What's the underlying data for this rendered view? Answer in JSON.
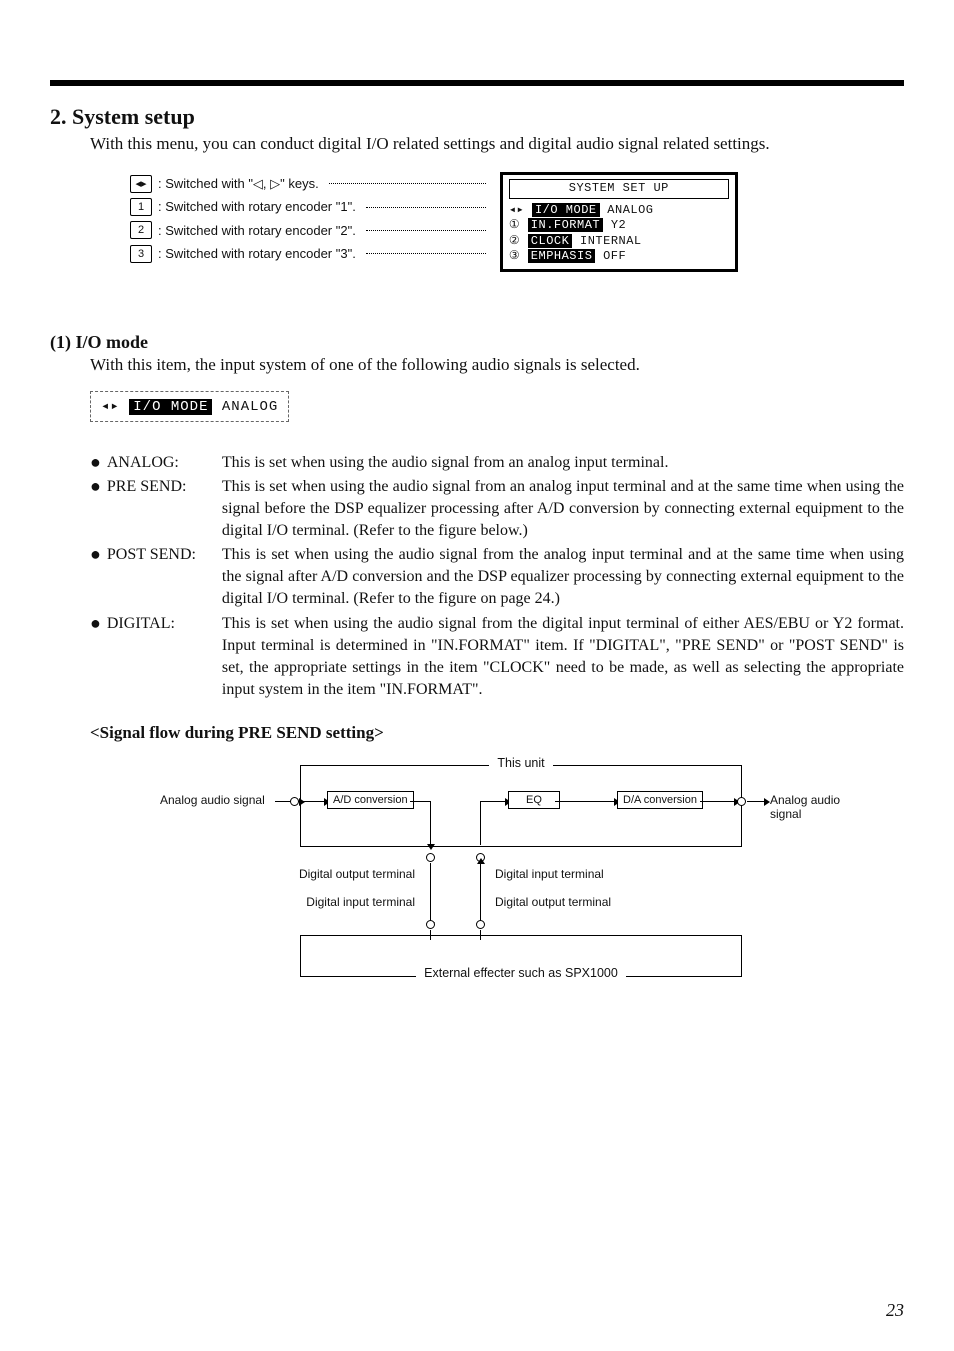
{
  "section": {
    "number": "2.",
    "title": "System setup",
    "intro": "With this menu, you can conduct digital I/O related settings and digital audio signal related settings."
  },
  "legend": {
    "items": [
      {
        "key": "◂▸",
        "text": ": Switched with \"◁, ▷\" keys."
      },
      {
        "key": "1",
        "text": ": Switched with rotary encoder \"1\"."
      },
      {
        "key": "2",
        "text": ": Switched with rotary encoder \"2\"."
      },
      {
        "key": "3",
        "text": ": Switched with rotary encoder \"3\"."
      }
    ]
  },
  "screen": {
    "title": "SYSTEM SET UP",
    "rows": [
      {
        "sym": "◂▸",
        "label": "I/O MODE",
        "value": "ANALOG"
      },
      {
        "sym": "①",
        "label": "IN.FORMAT",
        "value": "Y2"
      },
      {
        "sym": "②",
        "label": "CLOCK",
        "value": "INTERNAL"
      },
      {
        "sym": "③",
        "label": "EMPHASIS",
        "value": "OFF"
      }
    ]
  },
  "sub1": {
    "heading": "(1) I/O mode",
    "intro": "With this item, the input system of one of the following audio signals is selected.",
    "lcd": {
      "sym": "◂▸",
      "label": "I/O MODE",
      "value": "ANALOG"
    }
  },
  "options": [
    {
      "term": "ANALOG:",
      "desc": "This is set when using the audio signal from an analog input terminal."
    },
    {
      "term": "PRE SEND:",
      "desc": "This is set when using the audio signal from an analog input terminal and at the same time when using the signal before the DSP equalizer processing after A/D conversion by connecting external equipment to the digital I/O terminal. (Refer to the figure below.)"
    },
    {
      "term": "POST SEND:",
      "desc": "This is set when using the audio signal from the analog input terminal and at the same time when using the signal after A/D conversion and the DSP equalizer processing by connecting external equipment to the digital I/O terminal. (Refer to the figure on page 24.)"
    },
    {
      "term": "DIGITAL:",
      "desc": "This is set when using the audio signal from the digital input terminal of either AES/EBU or Y2 format. Input terminal is determined in \"IN.FORMAT\" item. If \"DIGITAL\", \"PRE SEND\" or \"POST SEND\" is set, the appropriate settings in the item \"CLOCK\" need to be made, as well as selecting the appropriate input system in the item \"IN.FORMAT\"."
    }
  ],
  "flow": {
    "title": "<Signal flow during PRE SEND setting>",
    "unit_label": "This unit",
    "in_label": "Analog audio signal",
    "out_label": "Analog audio signal",
    "ad": "A/D conversion",
    "eq": "EQ",
    "da": "D/A conversion",
    "dig_out1": "Digital output terminal",
    "dig_in1": "Digital input terminal",
    "dig_in2": "Digital input terminal",
    "dig_out2": "Digital output terminal",
    "external": "External effecter such as SPX1000"
  },
  "page_number": "23"
}
